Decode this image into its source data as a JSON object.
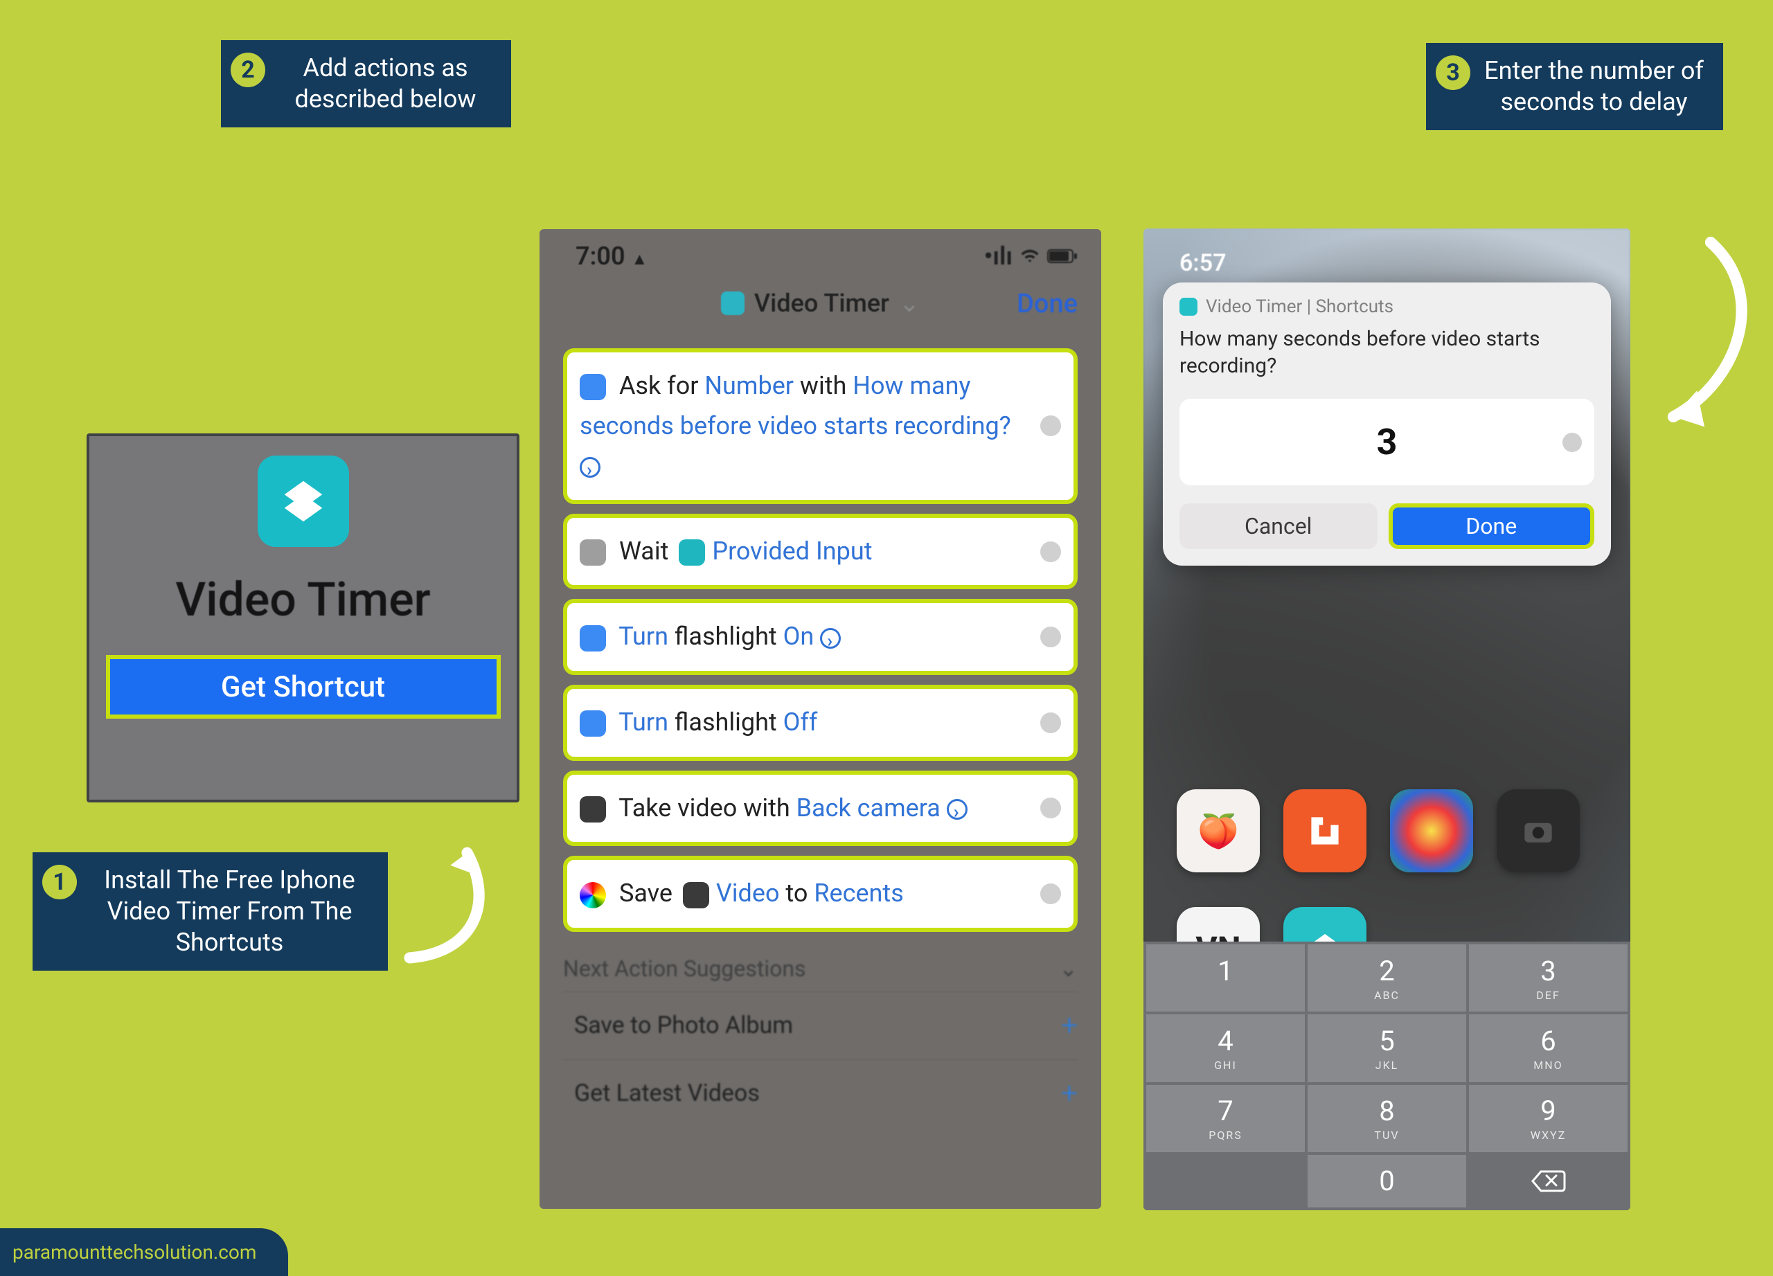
{
  "callouts": {
    "c1_num": "1",
    "c1_text": "Install The Free Iphone Video Timer From The Shortcuts",
    "c2_num": "2",
    "c2_text": "Add actions as described below",
    "c3_num": "3",
    "c3_text": "Enter the number of seconds to delay"
  },
  "panelA": {
    "title": "Video Timer",
    "button": "Get Shortcut"
  },
  "panelB": {
    "time": "7:00",
    "header_title": "Video Timer",
    "done": "Done",
    "action1": {
      "pre": "Ask for",
      "a": "Number",
      "mid": "with",
      "b": "How many seconds before video starts recording?"
    },
    "action2": {
      "pre": "Wait",
      "a": "Provided Input"
    },
    "action3": {
      "a": "Turn",
      "b": "flashlight",
      "c": "On"
    },
    "action4": {
      "a": "Turn",
      "b": "flashlight",
      "c": "Off"
    },
    "action5": {
      "pre": "Take video with",
      "a": "Back camera"
    },
    "action6": {
      "pre": "Save",
      "a": "Video",
      "mid": "to",
      "b": "Recents"
    },
    "suggest_header": "Next Action Suggestions",
    "suggest1": "Save to Photo Album",
    "suggest2": "Get Latest Videos"
  },
  "panelC": {
    "time": "6:57",
    "sheet_title": "Video Timer | Shortcuts",
    "prompt": "How many seconds before video starts recording?",
    "value": "3",
    "cancel": "Cancel",
    "done": "Done",
    "vn": "VN",
    "keys": {
      "k1": "1",
      "k2": "2",
      "k2s": "ABC",
      "k3": "3",
      "k3s": "DEF",
      "k4": "4",
      "k4s": "GHI",
      "k5": "5",
      "k5s": "JKL",
      "k6": "6",
      "k6s": "MNO",
      "k7": "7",
      "k7s": "PQRS",
      "k8": "8",
      "k8s": "TUV",
      "k9": "9",
      "k9s": "WXYZ",
      "k0": "0"
    }
  },
  "footer": "paramounttechsolution.com"
}
